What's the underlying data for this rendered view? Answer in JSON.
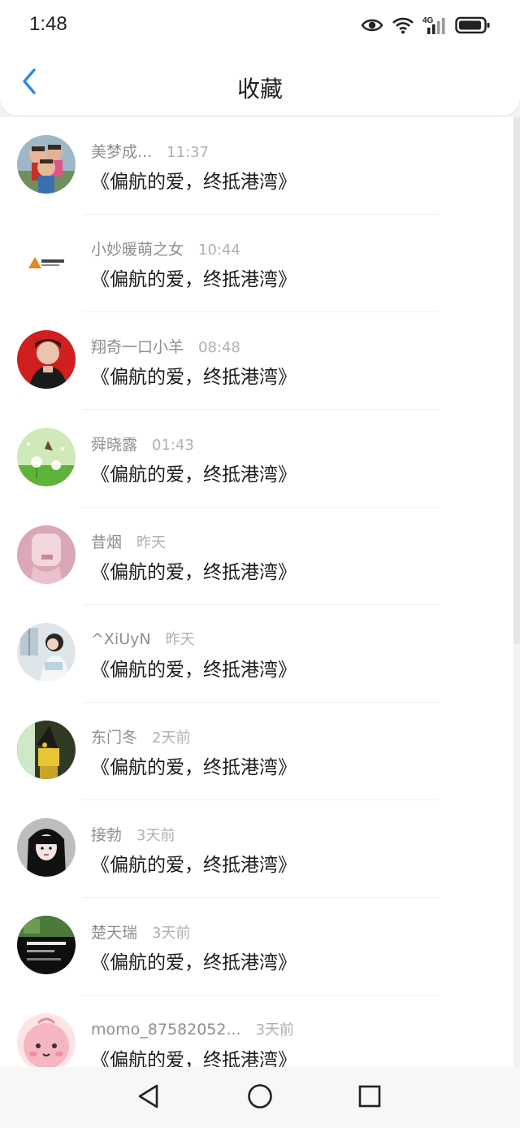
{
  "status_bar": {
    "time": "1:48",
    "icons": [
      "eye-icon",
      "wifi-icon",
      "signal-4g-icon",
      "battery-icon"
    ],
    "network_label": "4G"
  },
  "header": {
    "back_icon": "chevron-left-icon",
    "title": "收藏",
    "accent_color": "#2a8ae6"
  },
  "favorites": [
    {
      "name": "美梦成...",
      "time": "11:37",
      "text": "《偏航的爱，终抵港湾》",
      "avatar": "photo-two-children"
    },
    {
      "name": "小妙暖萌之女",
      "time": "10:44",
      "text": "《偏航的爱，终抵港湾》",
      "avatar": "logo-on-white"
    },
    {
      "name": "翔奇一口小羊",
      "time": "08:48",
      "text": "《偏航的爱，终抵港湾》",
      "avatar": "photo-red-background"
    },
    {
      "name": "舜晓露",
      "time": "01:43",
      "text": "《偏航的爱，终抵港湾》",
      "avatar": "dandelion-green"
    },
    {
      "name": "昔烟",
      "time": "昨天",
      "text": "《偏航的爱，终抵港湾》",
      "avatar": "photo-pink"
    },
    {
      "name": "^XiUyN",
      "time": "昨天",
      "text": "《偏航的爱，终抵港湾》",
      "avatar": "photo-girl-window"
    },
    {
      "name": "东门冬",
      "time": "2天前",
      "text": "《偏航的爱，终抵港湾》",
      "avatar": "anime-dark-green"
    },
    {
      "name": "接勃",
      "time": "3天前",
      "text": "《偏航的爱，终抵港湾》",
      "avatar": "illustration-dark-hair"
    },
    {
      "name": "楚天瑞",
      "time": "3天前",
      "text": "《偏航的爱，终抵港湾》",
      "avatar": "poster-dark-scene"
    },
    {
      "name": "momo_87582052...",
      "time": "3天前",
      "text": "《偏航的爱，终抵港湾》",
      "avatar": "cartoon-pink-face"
    }
  ],
  "nav_bar": {
    "icons": [
      "back-triangle-icon",
      "home-circle-icon",
      "recents-square-icon"
    ]
  }
}
